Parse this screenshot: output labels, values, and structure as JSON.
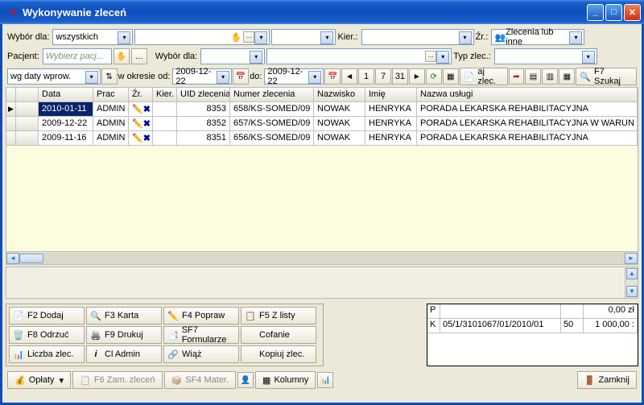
{
  "window": {
    "title": "Wykonywanie zleceń"
  },
  "filters": {
    "wybor_dla_lbl": "Wybór dla:",
    "wybor_dla_val": "wszystkich",
    "kier_lbl": "Kier.:",
    "zr_lbl": "Źr.:",
    "zr_val": "Zlecenia lub inne",
    "pacjent_lbl": "Pacjent:",
    "pacjent_ph": "Wybierz pacj...",
    "wybor_dla2_lbl": "Wybór dla:",
    "typ_zlec_lbl": "Typ zlec.:",
    "sort_val": "wg daty wprow.",
    "w_okresie_lbl": "w okresie od:",
    "date_from": "2009-12-22",
    "do_lbl": "do:",
    "date_to": "2009-12-22",
    "aj_zlec": "aj zlec.",
    "f7_szukaj": "F7 Szukaj",
    "cal_1": "1",
    "cal_7": "7",
    "cal_31": "31"
  },
  "grid": {
    "headers": [
      "",
      "Data",
      "Prac",
      "Źr.",
      "Kier.",
      "UID zlecenia",
      "Numer zlecenia",
      "Nazwisko",
      "Imię",
      "Nazwa usługi"
    ],
    "rows": [
      {
        "date": "2010-01-11",
        "prac": "ADMIN",
        "uid": "8353",
        "numer": "658/KS-SOMED/09",
        "nazwisko": "NOWAK",
        "imie": "HENRYKA",
        "usluga": "PORADA LEKARSKA REHABILITACYJNA"
      },
      {
        "date": "2009-12-22",
        "prac": "ADMIN",
        "uid": "8352",
        "numer": "657/KS-SOMED/09",
        "nazwisko": "NOWAK",
        "imie": "HENRYKA",
        "usluga": "PORADA LEKARSKA REHABILITACYJNA W WARUN"
      },
      {
        "date": "2009-11-16",
        "prac": "ADMIN",
        "uid": "8351",
        "numer": "656/KS-SOMED/09",
        "nazwisko": "NOWAK",
        "imie": "HENRYKA",
        "usluga": "PORADA LEKARSKA REHABILITACYJNA"
      }
    ]
  },
  "buttons": {
    "f2_dodaj": "F2 Dodaj",
    "f3_karta": "F3 Karta",
    "f4_popraw": "F4 Popraw",
    "f5_z_listy": "F5 Z listy",
    "f8_odrzuc": "F8 Odrzuć",
    "f9_drukuj": "F9 Drukuj",
    "sf7_form": "SF7 Formularze",
    "cofanie": "Cofanie",
    "liczba_zlec": "Liczba zlec.",
    "cl_admin": "Cl Admin",
    "wiaz": "Wiąż",
    "kopiuj_zlec": "Kopiuj zlec."
  },
  "summary": {
    "r1c1": "P",
    "r1c2": "",
    "r1c3": "",
    "r1c4": "0,00 zł",
    "r2c1": "K",
    "r2c2": "05/1/3101067/01/2010/01",
    "r2c3": "50",
    "r2c4": "1 000,00 :"
  },
  "footer": {
    "oplaty": "Opłaty",
    "f6_zam": "F6 Zam. zleceń",
    "sf4_mater": "SF4 Mater.",
    "kolumny": "Kolumny",
    "zamknij": "Zamknij"
  }
}
